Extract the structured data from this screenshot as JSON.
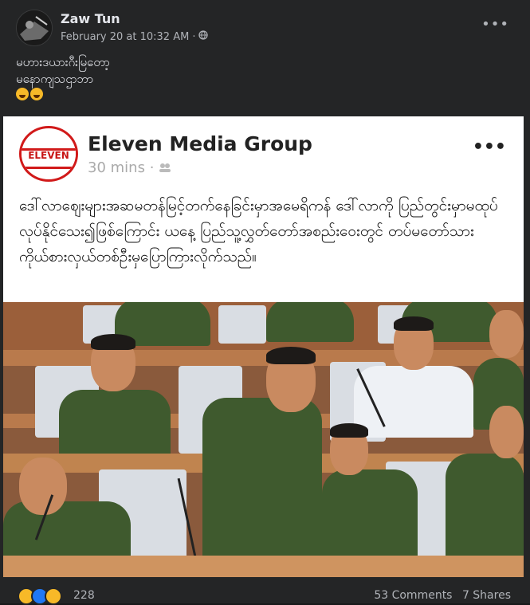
{
  "post": {
    "author": "Zaw Tun",
    "timestamp": "February 20 at 10:32 AM",
    "separator": "·",
    "privacy_icon": "globe-icon",
    "more_icon": "•••",
    "caption_lines": [
      "မဟားဒယားဂီးမြတော့",
      "မနောကျသဌာဘာ"
    ],
    "caption_emojis": [
      "sweat-smile",
      "laughing"
    ]
  },
  "shared": {
    "logo_text": "ELEVEN",
    "page_name": "Eleven Media Group",
    "time": "30 mins",
    "separator": "·",
    "more_icon": "•••",
    "text": "ဒေါ်လာဈေးများအဆမတန်မြင့်တက်နေခြင်းမှာအမေရိကန် ဒေါ်လာကို ပြည်တွင်းမှာမထုပ်လုပ်နိုင်သေး၍ဖြစ်ကြောင်း ယနေ့ ပြည်သူ့လွှတ်တော်အစည်းဝေးတွင် တပ်မတော်သား ကိုယ်စားလှယ်တစ်ဦးမှပြောကြားလိုက်သည်။"
  },
  "footer": {
    "reactions": [
      "haha",
      "like",
      "wow"
    ],
    "reaction_count": "228",
    "comments": "53 Comments",
    "shares": "7 Shares"
  },
  "colors": {
    "background": "#242526",
    "text": "#e4e6eb",
    "muted": "#b0b3b8",
    "eleven_red": "#d11a1a"
  }
}
